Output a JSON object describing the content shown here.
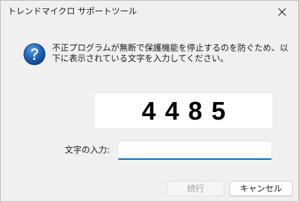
{
  "window": {
    "title": "トレンドマイクロ サポートツール"
  },
  "icons": {
    "close": "close-icon",
    "question": "question-icon",
    "question_color": "#1c5fb4"
  },
  "message": "不正プログラムが無断で保護機能を停止するのを防ぐため、以下に表示されている文字を入力してください。",
  "captcha": {
    "code": "4485"
  },
  "input": {
    "label": "文字の入力:",
    "value": ""
  },
  "buttons": {
    "continue_label": "続行",
    "cancel_label": "キャンセル"
  },
  "colors": {
    "accent": "#0067c0",
    "background": "#f0f0f0",
    "disabled_text": "#a0a0a0"
  }
}
